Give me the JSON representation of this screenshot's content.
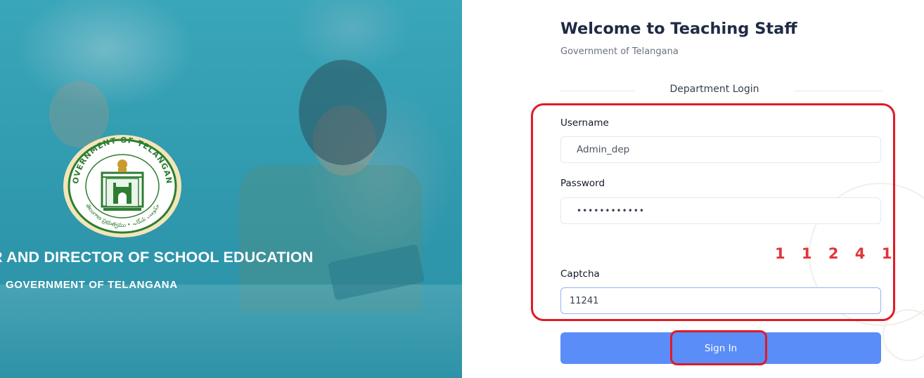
{
  "hero": {
    "title": "R AND DIRECTOR OF SCHOOL EDUCATION",
    "subtitle": "GOVERNMENT OF TELANGANA",
    "emblem": {
      "top_text": "GOVERNMENT OF TELANGANA",
      "bottom_text": "తెలంగాణ ప్రభుత్వము • حکومت تلنگانہ"
    }
  },
  "login": {
    "title": "Welcome to Teaching Staff",
    "subtitle": "Government of Telangana",
    "section_label": "Department Login",
    "username": {
      "label": "Username",
      "value": "Admin_dep"
    },
    "password": {
      "label": "Password",
      "value": "••••••••••••"
    },
    "captcha": {
      "code": "1 1 2 4 1",
      "label": "Captcha",
      "value": "11241"
    },
    "sign_in_label": "Sign In"
  },
  "colors": {
    "hero_teal": "#2f9db2",
    "accent_blue": "#5b8df8",
    "annotation_red": "#e01b24",
    "captcha_red": "#e0353a",
    "title_navy": "#1f2a44"
  }
}
